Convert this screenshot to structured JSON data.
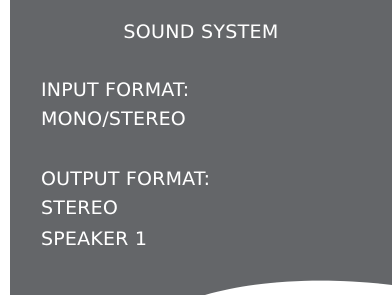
{
  "menu": {
    "title": "SOUND SYSTEM",
    "input_label": "INPUT FORMAT:",
    "input_value": "MONO/STEREO",
    "output_label": "OUTPUT FORMAT:",
    "output_value": "STEREO",
    "speaker_value": "SPEAKER 1"
  },
  "colors": {
    "screen_background": "#646669",
    "text": "#ffffff",
    "corner_wave": "#ffffff"
  }
}
